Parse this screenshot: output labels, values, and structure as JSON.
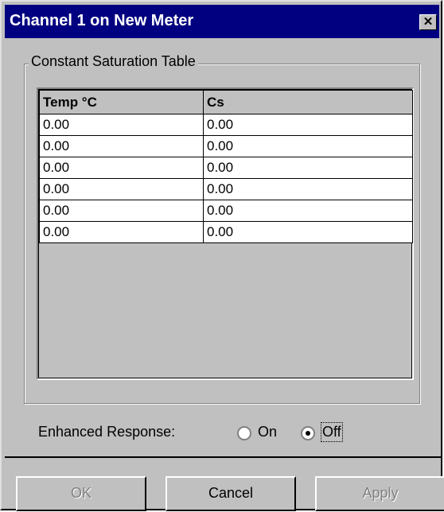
{
  "window": {
    "title": "Channel 1 on New Meter"
  },
  "close_icon": "close-icon",
  "group": {
    "label": "Constant Saturation Table"
  },
  "table": {
    "headers": [
      "Temp °C",
      "Cs"
    ],
    "rows": [
      [
        "0.00",
        "0.00"
      ],
      [
        "0.00",
        "0.00"
      ],
      [
        "0.00",
        "0.00"
      ],
      [
        "0.00",
        "0.00"
      ],
      [
        "0.00",
        "0.00"
      ],
      [
        "0.00",
        "0.00"
      ]
    ]
  },
  "enhanced_response": {
    "label": "Enhanced Response:",
    "options": [
      {
        "label": "On",
        "selected": false
      },
      {
        "label": "Off",
        "selected": true
      }
    ]
  },
  "buttons": {
    "ok": {
      "label": "OK",
      "enabled": false
    },
    "cancel": {
      "label": "Cancel",
      "enabled": true
    },
    "apply": {
      "label": "Apply",
      "enabled": false
    }
  }
}
